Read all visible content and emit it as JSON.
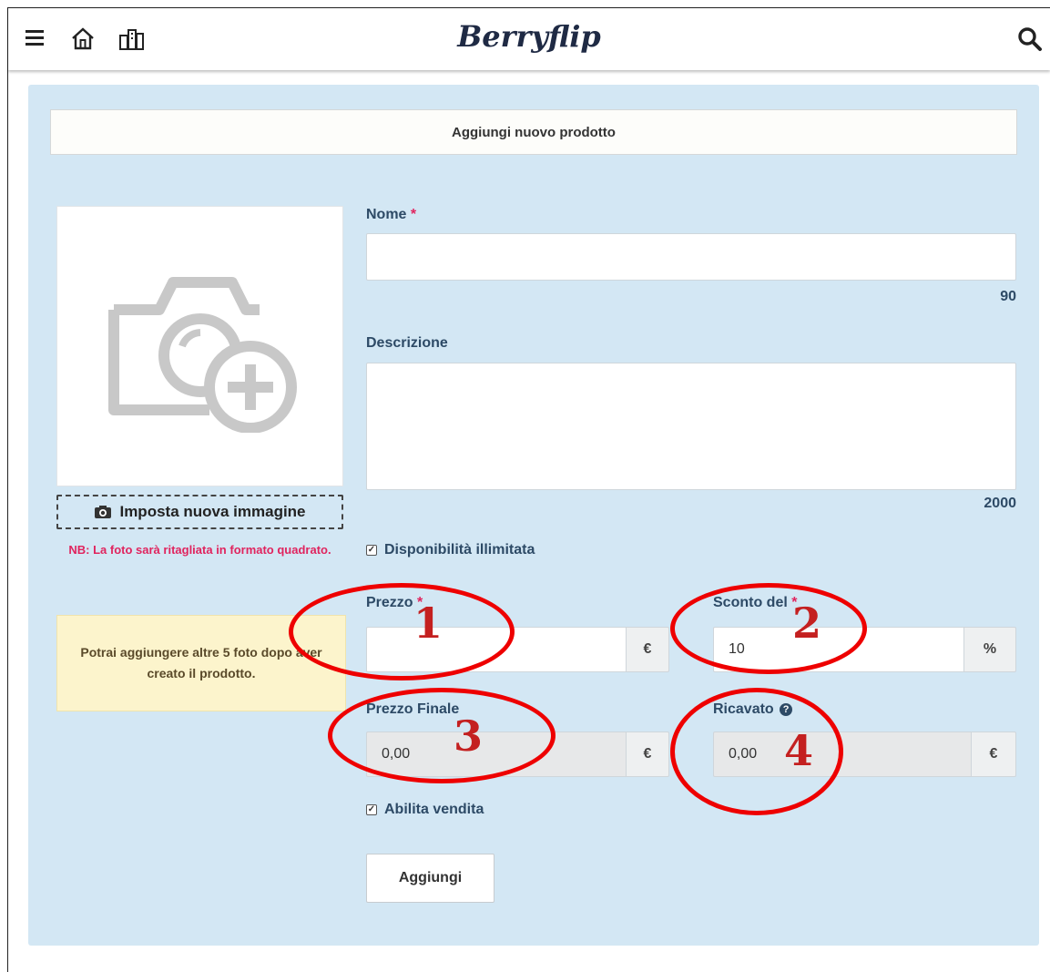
{
  "header": {
    "logo": "Berryflip",
    "menu_icon": "hamburger-menu-icon",
    "home_icon": "home-icon",
    "shop_icon": "city-buildings-icon",
    "search_icon": "search-icon"
  },
  "page": {
    "title": "Aggiungi nuovo prodotto"
  },
  "image_panel": {
    "placeholder_icon": "camera-add-icon",
    "set_image_label": "Imposta nuova immagine",
    "note": "NB: La foto sarà ritagliata in formato quadrato.",
    "info": "Potrai aggiungere altre 5 foto dopo aver creato il prodotto."
  },
  "form": {
    "name_label": "Nome",
    "required_mark": "*",
    "name_value": "",
    "name_counter": "90",
    "description_label": "Descrizione",
    "description_value": "",
    "description_counter": "2000",
    "unlimited_label": "Disponibilità illimitata",
    "unlimited_checked": true,
    "price_label": "Prezzo",
    "price_value": "",
    "price_unit": "€",
    "discount_label": "Sconto del",
    "discount_value": "10",
    "discount_unit": "%",
    "final_price_label": "Prezzo Finale",
    "final_price_value": "0,00",
    "final_price_unit": "€",
    "earnings_label": "Ricavato",
    "earnings_help": "?",
    "earnings_value": "0,00",
    "earnings_unit": "€",
    "enable_sale_label": "Abilita vendita",
    "enable_sale_checked": true,
    "submit_label": "Aggiungi"
  },
  "annotations": {
    "n1": "1",
    "n2": "2",
    "n3": "3",
    "n4": "4",
    "color": "#ee0000"
  }
}
